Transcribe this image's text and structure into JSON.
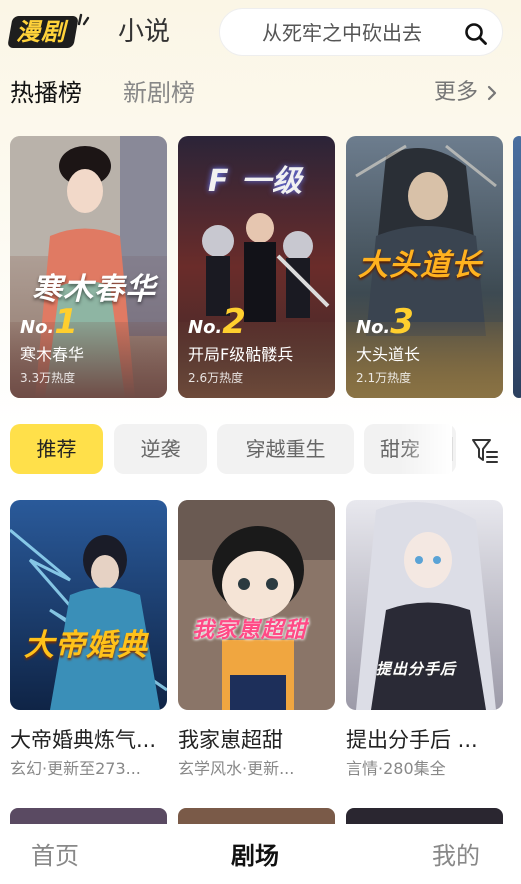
{
  "header": {
    "logo_text": "漫剧",
    "novel_tab": "小说",
    "search_placeholder": "从死牢之中砍出去"
  },
  "rank_tabs": {
    "active": "热播榜",
    "inactive": "新剧榜",
    "more": "更多"
  },
  "rank_cards": [
    {
      "rank_prefix": "No.",
      "rank": "1",
      "title": "寒木春华",
      "heat": "3.3万热度",
      "art_text": "寒木春华"
    },
    {
      "rank_prefix": "No.",
      "rank": "2",
      "title": "开局F级骷髅兵",
      "heat": "2.6万热度",
      "art_text": "F 一级"
    },
    {
      "rank_prefix": "No.",
      "rank": "3",
      "title": "大头道长",
      "heat": "2.1万热度",
      "art_text": "大头道长"
    }
  ],
  "chips": [
    "推荐",
    "逆袭",
    "穿越重生",
    "甜宠"
  ],
  "grid": [
    {
      "title": "大帝婚典炼气...",
      "meta": "玄幻·更新至273...",
      "art_text": "大帝婚典"
    },
    {
      "title": "我家崽超甜",
      "meta": "玄学风水·更新...",
      "art_text": "我家崽超甜"
    },
    {
      "title": "提出分手后 ...",
      "meta": "言情·280集全",
      "art_text": "提出分手后"
    }
  ],
  "bottom_nav": {
    "home": "首页",
    "theater": "剧场",
    "mine": "我的"
  },
  "colors": {
    "accent": "#ffe04a",
    "rank_number": "#ffcf2e"
  }
}
